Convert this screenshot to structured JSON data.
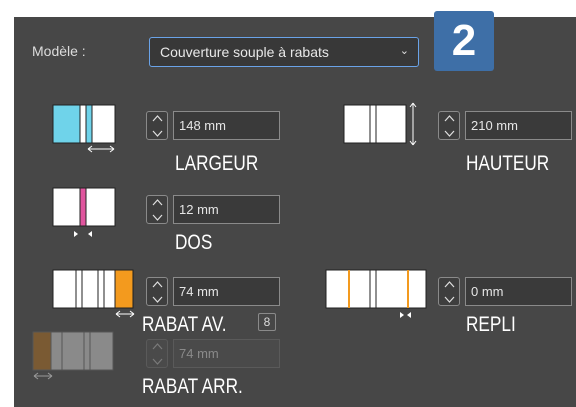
{
  "model": {
    "label": "Modèle :",
    "selected": "Couverture souple à rabats"
  },
  "step_badge": "2",
  "fields": {
    "largeur": {
      "value": "148 mm",
      "caption": "LARGEUR"
    },
    "hauteur": {
      "value": "210 mm",
      "caption": "HAUTEUR"
    },
    "dos": {
      "value": "12 mm",
      "caption": "DOS"
    },
    "rabat_av": {
      "value": "74 mm",
      "caption": "RABAT AV."
    },
    "repli": {
      "value": "0 mm",
      "caption": "REPLI"
    },
    "rabat_arr": {
      "value": "74 mm",
      "caption": "RABAT ARR."
    }
  },
  "colors": {
    "panel_bg": "#474747",
    "accent_cyan": "#6fd3ea",
    "accent_pink": "#e0559e",
    "accent_orange": "#f39a1e",
    "accent_brown": "#7a5a33",
    "badge_blue": "#3e6fa7",
    "focus_blue": "#6aa3e8"
  },
  "icons": [
    "width-diagram-icon",
    "height-diagram-icon",
    "spine-diagram-icon",
    "front-flap-diagram-icon",
    "fold-diagram-icon",
    "back-flap-diagram-icon",
    "link-icon",
    "chevron-down-icon"
  ]
}
